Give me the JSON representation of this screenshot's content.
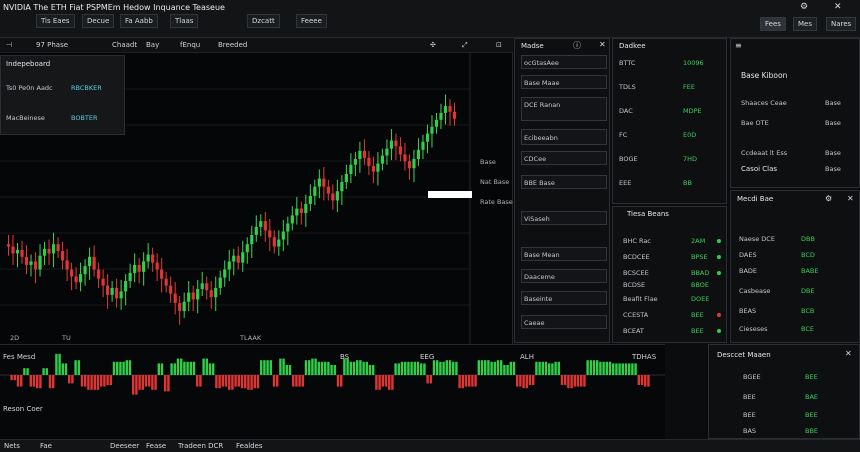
{
  "app": {
    "title": "NVIDIA  The ETH  Fiat PSPMEm  Hedow  Inquance  Teaseue",
    "tabs": [
      "Tis Eaes",
      "Decue",
      "Fa Aabb",
      "Tlaas",
      "Dzcatt",
      "Feeee"
    ],
    "right_buttons": [
      "Fees",
      "Mes",
      "Nares"
    ]
  },
  "chart": {
    "toolbar": [
      "97 Phase",
      "Chaadt",
      "Bay",
      "fEnqu",
      "Breeded"
    ],
    "overlay": {
      "title": "Indepeboard",
      "rows": [
        {
          "label": "Ts0  Pe0n Aadc",
          "value": "RBCBKER"
        },
        {
          "label": "MacBeinese",
          "value": "BOBTER"
        }
      ]
    },
    "price_labels": [
      "Base",
      "Nat Base",
      "Rate Base"
    ],
    "bottom_ticks": [
      "2D",
      "TU",
      "TLAAK"
    ]
  },
  "indicator": {
    "label_left_1": "Fes Mesd",
    "label_left_2": "Reson Coer",
    "right_value": "TDHAS",
    "tick_labels": [
      "BS",
      "EEG",
      "ALH"
    ]
  },
  "orderbook": {
    "title": "Madse",
    "items": [
      "ocGtasAee",
      "Base  Maae",
      "DCE Ranan",
      "Ecibeeabn",
      "CDCee",
      "BBE Base",
      "ViSaseh",
      "Base Mean",
      "Daaceme",
      "Baseinte",
      "Caeae"
    ]
  },
  "watchlist": {
    "title": "Dadkee",
    "rows": [
      {
        "sym": "BTTC",
        "val": "10096"
      },
      {
        "sym": "TDLS",
        "val": "FEE"
      },
      {
        "sym": "DAC",
        "val": "MDPE"
      },
      {
        "sym": "FC",
        "val": "E0D"
      },
      {
        "sym": "BOGE",
        "val": "7HD"
      },
      {
        "sym": "EEE",
        "val": "BB"
      }
    ]
  },
  "positions": {
    "title": "Tiesa Beans",
    "rows": [
      {
        "sym": "BHC Rac",
        "val": "2AM"
      },
      {
        "sym": "BCDCEE",
        "val": "BPSE"
      },
      {
        "sym": "BCSCEE",
        "val": "BBAD"
      },
      {
        "sym": "BCDSE",
        "val": "BBOE"
      },
      {
        "sym": "Beafit Flae",
        "val": "DOEE"
      },
      {
        "sym": "CCESTA",
        "val": "BEE"
      },
      {
        "sym": "BCEAT",
        "val": "BEE"
      }
    ]
  },
  "account": {
    "title": "Base Kiboon",
    "rows": [
      "Shaaces Ceae",
      "Bae OTE",
      "Ccdeaat lt Ess",
      "Casoi Clas"
    ],
    "right_values": [
      "Base",
      "Base",
      "Base",
      "Base"
    ]
  },
  "depth": {
    "title": "Mecdi Bae",
    "rows": [
      "Naese DCE",
      "DAES",
      "BADE",
      "Casbease",
      "BEAS",
      "Cieseses"
    ],
    "values": [
      "DBB",
      "BCD",
      "BABE",
      "DBE",
      "BCB",
      "BCE"
    ]
  },
  "trades": {
    "title": "Desccet Maaen",
    "rows": [
      {
        "a": "BGEE",
        "b": "BEE"
      },
      {
        "a": "BEE",
        "b": "BAE"
      },
      {
        "a": "BEE",
        "b": "BEE"
      },
      {
        "a": "BAS",
        "b": "BBE"
      }
    ]
  },
  "bottom": {
    "items": [
      "Nets",
      "Fae",
      "Deeseer",
      "Fease",
      "Tradeen DCR",
      "Fealdes"
    ]
  },
  "chart_values": {
    "candles": [
      420,
      418,
      412,
      415,
      409,
      402,
      405,
      398,
      410,
      416,
      412,
      420,
      414,
      406,
      398,
      392,
      387,
      394,
      401,
      409,
      398,
      390,
      384,
      376,
      382,
      373,
      379,
      388,
      395,
      402,
      396,
      405,
      411,
      404,
      398,
      390,
      384,
      377,
      369,
      362,
      370,
      378,
      372,
      381,
      386,
      380,
      374,
      382,
      391,
      398,
      405,
      410,
      404,
      413,
      420,
      428,
      435,
      440,
      432,
      426,
      418,
      424,
      431,
      438,
      445,
      451,
      447,
      455,
      462,
      470,
      477,
      470,
      464,
      458,
      466,
      474,
      481,
      489,
      494,
      501,
      495,
      488,
      483,
      490,
      497,
      503,
      510,
      505,
      498,
      492,
      486,
      494,
      502,
      509,
      516,
      522,
      528,
      534,
      540,
      535,
      529
    ]
  }
}
